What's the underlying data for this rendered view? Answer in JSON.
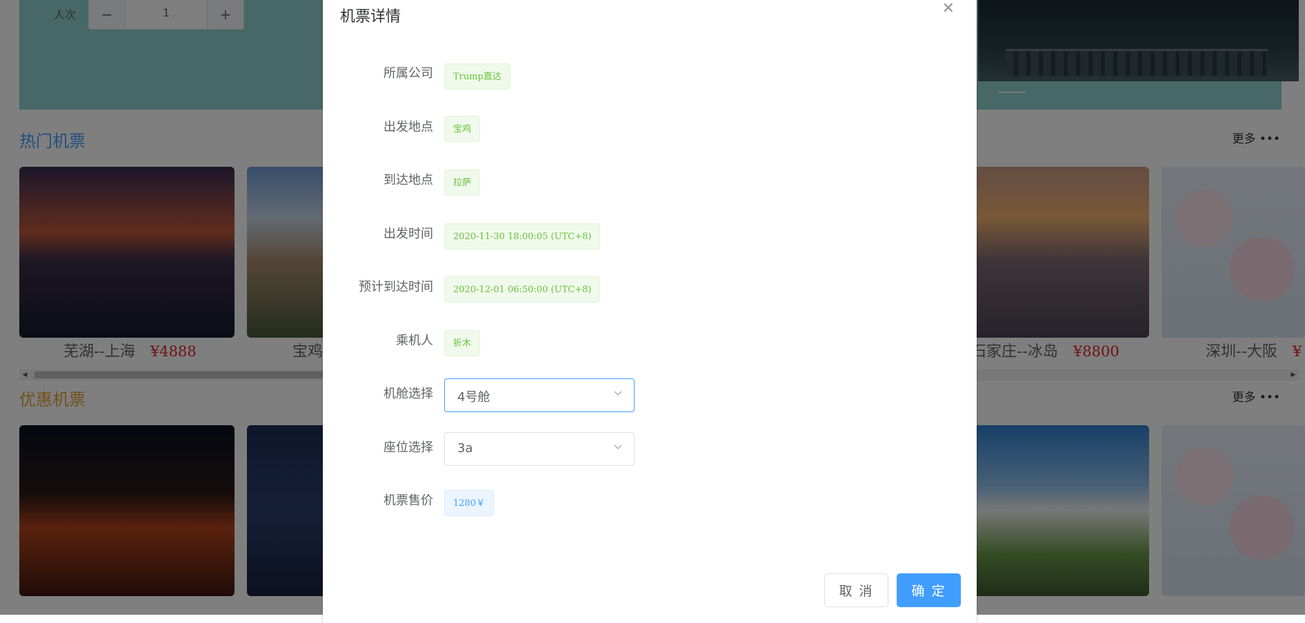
{
  "background": {
    "people_label": "人次",
    "people_count": "1",
    "hot_section": {
      "title": "热门机票",
      "more": "更多",
      "cards": [
        {
          "route": "芜湖--上海",
          "price": "¥4888"
        },
        {
          "route": "宝鸡",
          "price": ""
        },
        {
          "route": "石家庄--冰岛",
          "price": "¥8800"
        },
        {
          "route": "深圳--大阪",
          "price": "¥"
        }
      ]
    },
    "discount_section": {
      "title": "优惠机票",
      "more": "更多"
    }
  },
  "dialog": {
    "title": "机票详情",
    "fields": {
      "company": {
        "label": "所属公司",
        "value": "Trump直达"
      },
      "departure_place": {
        "label": "出发地点",
        "value": "宝鸡"
      },
      "arrival_place": {
        "label": "到达地点",
        "value": "拉萨"
      },
      "departure_time": {
        "label": "出发时间",
        "value": "2020-11-30 18:00:05 (UTC+8)"
      },
      "arrival_time": {
        "label": "预计到达时间",
        "value": "2020-12-01 06:50:00 (UTC+8)"
      },
      "passenger": {
        "label": "乘机人",
        "value": "折木"
      },
      "cabin": {
        "label": "机舱选择",
        "value": "4号舱"
      },
      "seat": {
        "label": "座位选择",
        "value": "3a"
      },
      "price": {
        "label": "机票售价",
        "value": "1280￥"
      }
    },
    "buttons": {
      "cancel": "取 消",
      "confirm": "确 定"
    }
  },
  "colors": {
    "primary": "#409eff",
    "success": "#67c23a",
    "hot_title": "#409eff",
    "discount_title": "#e6a23c",
    "price_red": "#e02020"
  }
}
